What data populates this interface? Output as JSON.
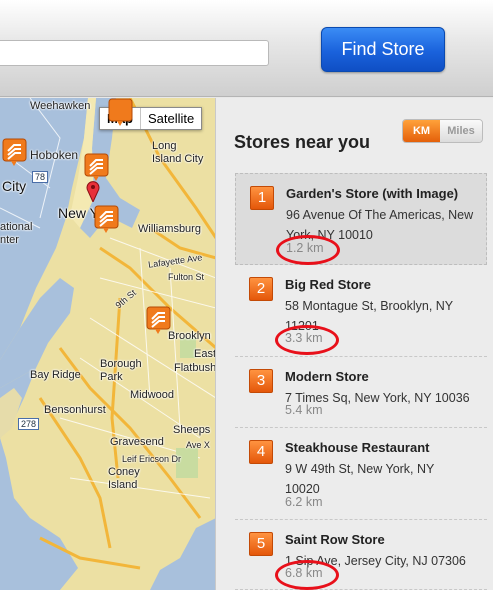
{
  "header": {
    "search_value": "",
    "find_button": "Find Store"
  },
  "map": {
    "type_map": "Map",
    "type_satellite": "Satellite",
    "labels": {
      "weehawken": "Weehawken",
      "hoboken": "Hoboken",
      "city": "City",
      "ational": "ational",
      "nter": "nter",
      "new_york": "New York",
      "long_island_city": "Long\nIsland City",
      "williamsburg": "Williamsburg",
      "lafayette": "Lafayette Ave",
      "fulton": "Fulton St",
      "ninth": "9th St",
      "brooklyn": "Brooklyn",
      "borough_park": "Borough\nPark",
      "east": "East",
      "flatbush": "Flatbush",
      "bay_ridge": "Bay Ridge",
      "midwood": "Midwood",
      "bensonhurst": "Bensonhurst",
      "gravesend": "Gravesend",
      "sheeps": "Sheeps",
      "ave_x": "Ave X",
      "coney": "Coney\nIsland",
      "ericson": "Leif Ericson Dr",
      "shield_78": "78",
      "shield_278": "278"
    }
  },
  "sidebar": {
    "title": "Stores near you",
    "unit_km": "KM",
    "unit_miles": "Miles",
    "stores": [
      {
        "num": "1",
        "name": "Garden's Store (with Image)",
        "address": "96 Avenue Of The Americas, New York, NY 10010",
        "distance": "1.2 km"
      },
      {
        "num": "2",
        "name": "Big Red Store",
        "address": "58 Montague St, Brooklyn, NY 11201",
        "distance": "3.3 km"
      },
      {
        "num": "3",
        "name": "Modern Store",
        "address": "7 Times Sq, New York, NY 10036",
        "distance": "5.4 km"
      },
      {
        "num": "4",
        "name": "Steakhouse Restaurant",
        "address": "9 W 49th St, New York, NY 10020",
        "distance": "6.2 km"
      },
      {
        "num": "5",
        "name": "Saint Row Store",
        "address": "1 Sip Ave, Jersey City, NJ 07306",
        "distance": "6.8 km"
      }
    ]
  },
  "colors": {
    "accent_orange": "#e4600a",
    "button_blue": "#1a62dc",
    "highlight_red": "#e8101a",
    "water": "#9fb8d6",
    "land": "#eddf9a"
  }
}
